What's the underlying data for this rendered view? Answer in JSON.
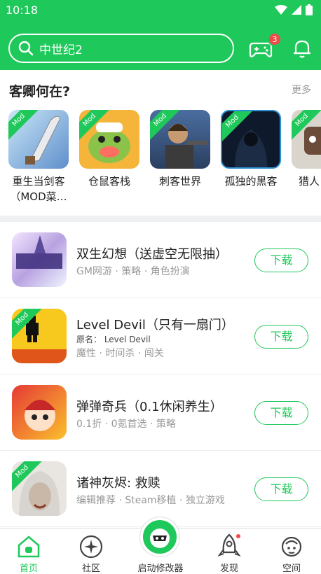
{
  "status": {
    "time": "10:18"
  },
  "header": {
    "search_text": "中世纪2",
    "notification_badge": "3"
  },
  "featured": {
    "title": "客卿何在?",
    "more": "更多",
    "mod_tag": "Mod",
    "items": [
      {
        "label": "重生当剑客（MOD菜…"
      },
      {
        "label": "仓鼠客栈"
      },
      {
        "label": "刺客世界"
      },
      {
        "label": "孤独的黑客"
      },
      {
        "label": "猎人"
      }
    ]
  },
  "list": [
    {
      "title": "双生幻想（送虚空无限抽）",
      "tags": "GM网游 · 策略 · 角色扮演",
      "button": "下载"
    },
    {
      "title": "Level Devil（只有一扇门）",
      "original": "原名：  Level Devil",
      "tags": "魔性 · 时间杀 · 闯关",
      "button": "下载"
    },
    {
      "title": "弹弹奇兵（0.1休闲养生）",
      "tags": "0.1折 · 0氪首选 · 策略",
      "button": "下载"
    },
    {
      "title": "诸神灰烬: 救赎",
      "tags": "编辑推荐 · Steam移植 · 独立游戏",
      "button": "下载"
    }
  ],
  "tabs": [
    {
      "label": "首页",
      "active": true
    },
    {
      "label": "社区"
    },
    {
      "label": "启动修改器"
    },
    {
      "label": "发现"
    },
    {
      "label": "空间"
    }
  ],
  "colors": {
    "accent": "#1fc85a",
    "badge": "#f04b4b"
  }
}
